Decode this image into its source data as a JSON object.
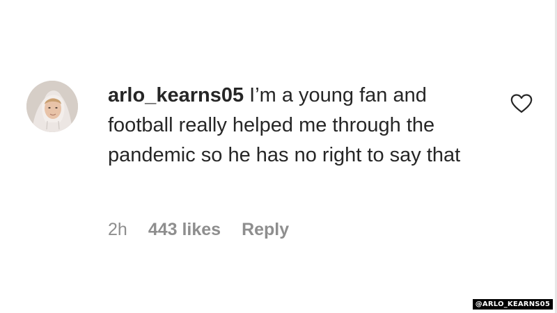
{
  "comment": {
    "username": "arlo_kearns05",
    "text": " I’m a young fan and football really helped me through the pandemic so he has no right to say that",
    "time": "2h",
    "likes": "443 likes",
    "reply_label": "Reply"
  },
  "icons": {
    "like": "heart-outline-icon",
    "avatar": "profile-photo"
  },
  "credit": "@ARLO_KEARNS05",
  "colors": {
    "text": "#262626",
    "secondary": "#8e8e8e",
    "background": "#ffffff"
  }
}
